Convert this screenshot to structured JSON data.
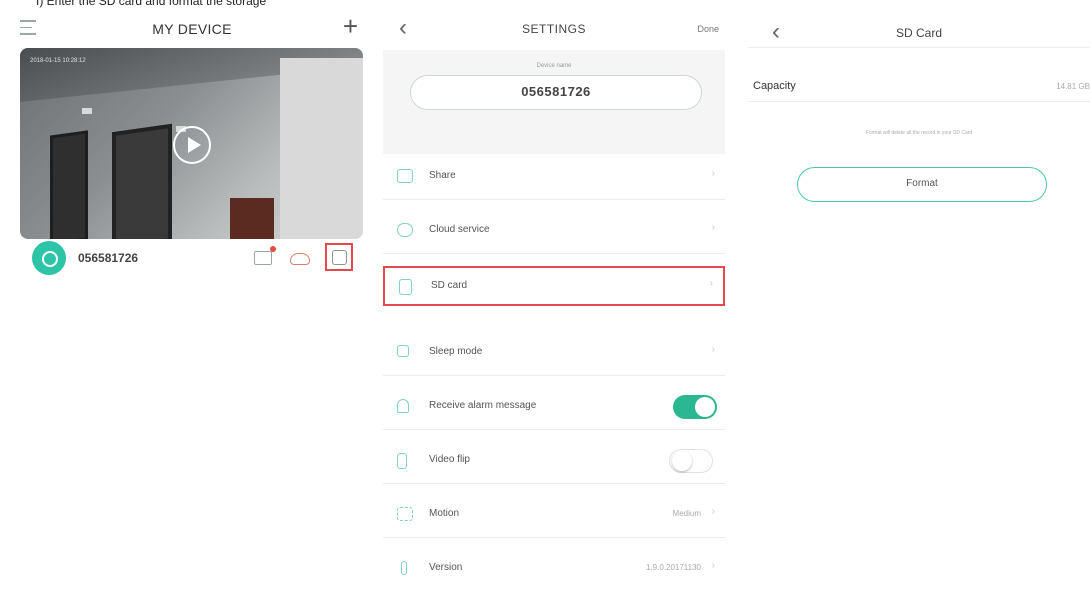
{
  "caption": "I) Enter the SD card and format the storage",
  "device_list": {
    "title": "MY DEVICE",
    "video_timestamp": "2018-01-15 10:28:12",
    "device_name": "056581726",
    "icons": [
      "menu-icon",
      "plus-icon",
      "play-icon",
      "share-icon",
      "cloud-icon",
      "settings-icon"
    ]
  },
  "settings": {
    "title": "SETTINGS",
    "done_label": "Done",
    "device_name_label": "Device name",
    "device_name_value": "056581726",
    "rows": [
      {
        "label": "Share",
        "value": "",
        "control": "chevron"
      },
      {
        "label": "Cloud service",
        "value": "",
        "control": "chevron"
      },
      {
        "label": "SD card",
        "value": "",
        "control": "chevron"
      },
      {
        "label": "Sleep mode",
        "value": "",
        "control": "chevron"
      },
      {
        "label": "Receive alarm message",
        "value": "",
        "control": "toggle",
        "on": true
      },
      {
        "label": "Video flip",
        "value": "",
        "control": "toggle",
        "on": false
      },
      {
        "label": "Motion",
        "value": "Medium",
        "control": "chevron"
      },
      {
        "label": "Version",
        "value": "1.9.0.20171130",
        "control": "chevron"
      }
    ],
    "chevron": "›"
  },
  "sd_card": {
    "title": "SD Card",
    "capacity_label": "Capacity",
    "capacity_value": "14.81 GB",
    "note": "Format will delete all the record in your SD Card",
    "format_label": "Format"
  },
  "colors": {
    "accent": "#2bb78f",
    "highlight": "#e5484d"
  },
  "back_glyph": "‹",
  "plus_glyph": "+"
}
